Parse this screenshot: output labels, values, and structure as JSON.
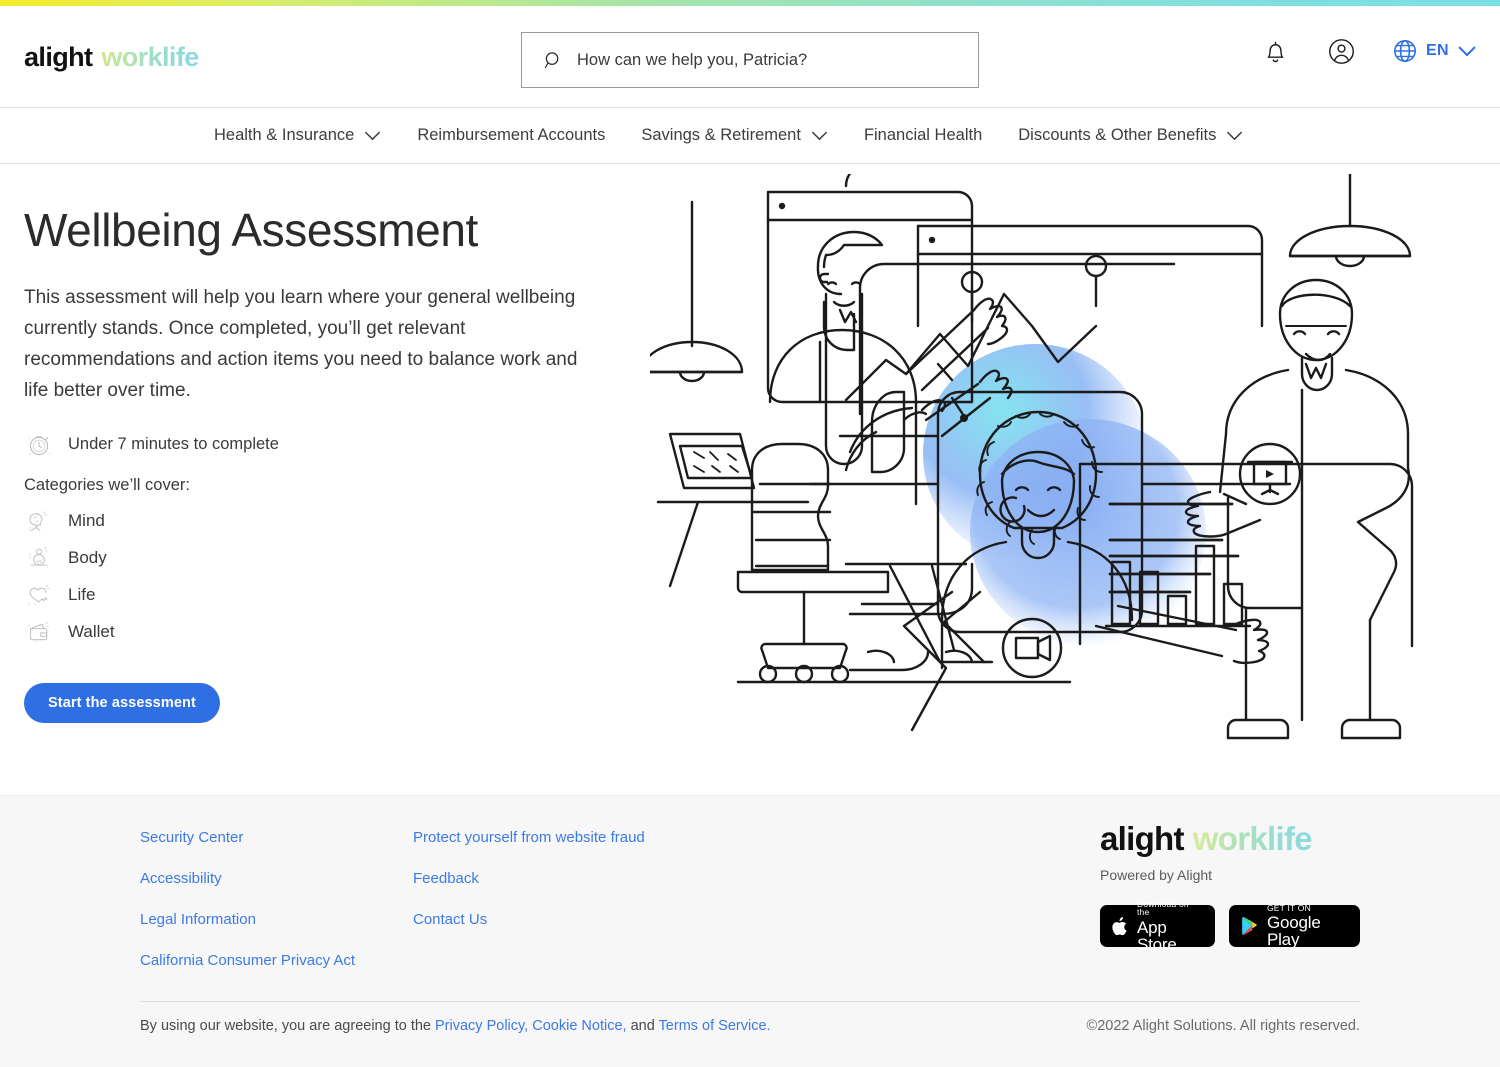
{
  "brand": {
    "name_dark": "alight",
    "name_light": "worklife",
    "accent": "#2f6fe4",
    "gradient_from": "#f5ec2e",
    "gradient_to": "#79e0e6"
  },
  "header": {
    "search": {
      "placeholder": "How can we help you, Patricia?",
      "value": ""
    },
    "notifications_icon": "bell-icon",
    "account_icon": "account-icon",
    "language": {
      "code": "EN",
      "globe_icon": "globe-icon",
      "chevron_icon": "chevron-down-icon"
    }
  },
  "nav": {
    "items": [
      {
        "label": "Health & Insurance",
        "has_dropdown": true
      },
      {
        "label": "Reimbursement Accounts",
        "has_dropdown": false
      },
      {
        "label": "Savings & Retirement",
        "has_dropdown": true
      },
      {
        "label": "Financial Health",
        "has_dropdown": false
      },
      {
        "label": "Discounts & Other Benefits",
        "has_dropdown": true
      }
    ]
  },
  "hero": {
    "title": "Wellbeing Assessment",
    "description": "This assessment will help you learn where your general wellbeing currently stands. Once completed, you’ll get relevant recommendations and action items you need to balance work and life better over time.",
    "duration": "Under 7 minutes to complete",
    "duration_icon": "stopwatch-icon",
    "categories_label": "Categories we’ll cover:",
    "categories": [
      {
        "label": "Mind",
        "icon": "mind-head-icon"
      },
      {
        "label": "Body",
        "icon": "body-meditation-icon"
      },
      {
        "label": "Life",
        "icon": "life-heart-icon"
      },
      {
        "label": "Wallet",
        "icon": "wallet-icon"
      }
    ],
    "cta_label": "Start the assessment"
  },
  "footer": {
    "links_col1": [
      "Security Center",
      "Accessibility",
      "Legal Information",
      "California Consumer Privacy Act"
    ],
    "links_col2": [
      "Protect yourself from website fraud",
      "Feedback",
      "Contact Us"
    ],
    "brand_dark": "alight",
    "brand_light": "worklife",
    "powered_by": "Powered by Alight",
    "app_store": {
      "small": "Download on the",
      "big": "App Store",
      "icon": "apple-icon"
    },
    "google_play": {
      "small": "GET IT ON",
      "big": "Google Play",
      "icon": "google-play-icon"
    },
    "legal_prefix": "By using our website, you are agreeing to the ",
    "legal_link1": "Privacy Policy,",
    "legal_link2": "Cookie Notice,",
    "legal_mid": " and ",
    "legal_link3": "Terms of Service.",
    "copyright": "©2022 Alight Solutions. All rights reserved."
  },
  "illustration": {
    "name": "wellbeing-hero-illustration",
    "description": "Line-art scene of remote collaboration: browser windows, charts, a seated person at a desk with a laptop, a woman with afro hair in a video-call card highlighted by a blue gradient blob, a standing man, and two hanging pendant lamps.",
    "blob_color_a": "#8fd8f0",
    "blob_color_b": "#7fa6f0",
    "stroke_color": "#1b1b1b"
  }
}
